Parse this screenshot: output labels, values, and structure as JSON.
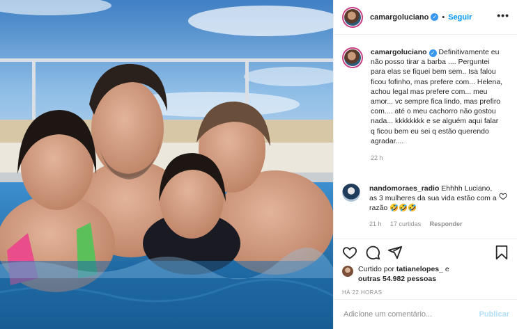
{
  "post": {
    "username": "camargoluciano",
    "follow_label": "Seguir",
    "more_label": "•••",
    "caption": "Definitivamente eu não posso tirar a barba .... Perguntei para elas se fiquei bem sem.. Isa falou ficou fofinho, mas prefere com... Helena, achou legal mas prefere com... meu amor... vc sempre fica lindo, mas prefiro com.... até o meu cachorro não gostou nada... kkkkkkkk e se alguém aqui falar q ficou bem eu sei q estão querendo agradar....",
    "caption_age": "22 h"
  },
  "comment": {
    "username": "nandomoraes_radio",
    "text": "Ehhhh Luciano, as 3 mulheres da sua vida estão com a razão 🤣🤣🤣",
    "age": "21 h",
    "likes": "17 curtidas",
    "reply_label": "Responder"
  },
  "likes": {
    "prefix": "Curtido por",
    "first_user": "tatianelopes_",
    "connector": "e",
    "others": "outras 54.982 pessoas"
  },
  "timestamp": "HÁ 22 HORAS",
  "add_comment": {
    "placeholder": "Adicione um comentário...",
    "publish_label": "Publicar"
  },
  "icons": [
    "heart-icon",
    "comment-icon",
    "share-icon",
    "bookmark-icon",
    "verified-icon",
    "more-icon"
  ],
  "colors": {
    "accent_blue": "#0095f6",
    "verified_blue": "#3897f0",
    "muted_text": "#8e8e8e",
    "publish_disabled": "#b2dffc"
  }
}
